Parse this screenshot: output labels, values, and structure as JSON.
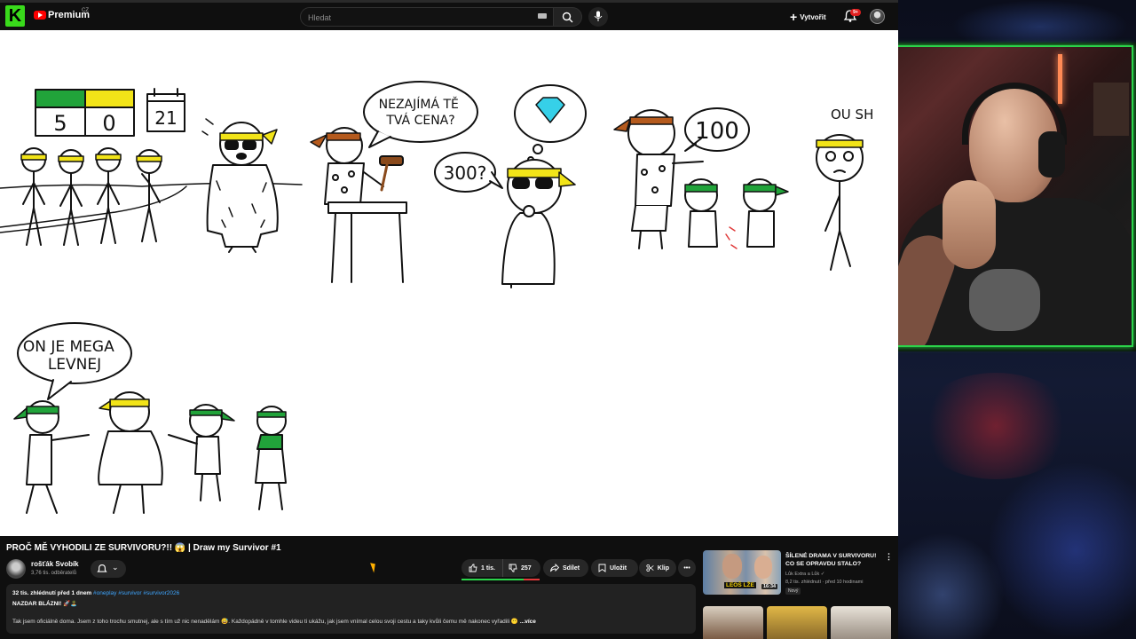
{
  "header": {
    "brand_letter": "K",
    "app_title": "Premium",
    "country": "CZ",
    "search_placeholder": "Hledat",
    "create_label": "Vytvořit",
    "notif_badge": "9+"
  },
  "video": {
    "scoreboard": {
      "green": "5",
      "yellow": "0",
      "calendar": "21"
    },
    "bubble_1": "NEZAJÍMÁ TĚ TVÁ CENA?",
    "bubble_2": "300?",
    "bubble_3": "100",
    "bubble_4": "OU SH",
    "bubble_5": "ON JE MEGA LEVNEJ"
  },
  "info": {
    "title": "PROČ MĚ VYHODILI ZE SURVIVORU?!! 😱 | Draw my Survivor #1",
    "channel_name": "rošťák Svobík",
    "channel_subs": "3,76 tis. odběratelů",
    "likes": "1 tis.",
    "dislikes": "257",
    "share_label": "Sdílet",
    "save_label": "Uložit",
    "clip_label": "Klip",
    "like_ratio": 0.8,
    "desc_meta": "32 tis. zhlédnutí  před 1 dnem ",
    "desc_tags": "#oneplay #survivor #survivor2026",
    "desc_line1": "NAZDAR BLÁZNI! 🚀🏝️",
    "desc_line2": "Tak jsem oficiálně doma. Jsem z toho trochu smutnej, ale s tím už nic nenadělám 😅. Každopádně v tomhle videu ti ukážu, jak jsem vnímal celou svoji cestu a taky kvůli čemu mě nakonec vyřadili 😶 ",
    "desc_more": "...více"
  },
  "recommended": [
    {
      "title": "ŠÍLENÉ DRAMA V SURVIVORU! CO SE OPRAVDU STALO?",
      "channel": "Lůk Extra a Lůk ✓",
      "views": "8,2 tis. zhlédnutí · před 10 hodinami",
      "badge": "Nový",
      "thumb_tag": "LEOŠ LŽE",
      "duration": "16:34"
    }
  ],
  "colors": {
    "accent_green": "#2bd34a",
    "yt_red": "#ff0000",
    "yellow_band": "#f2e418",
    "green_band": "#21a33a"
  }
}
